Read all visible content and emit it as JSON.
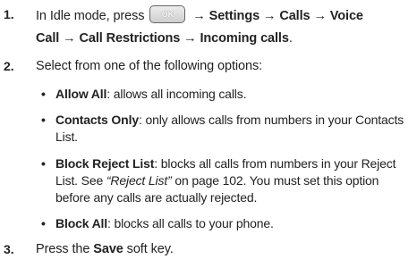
{
  "step1": {
    "number": "1.",
    "pre": "In Idle mode, press",
    "ok_key": "OK",
    "arrow1": "→",
    "settings": "Settings",
    "arrow2": "→",
    "calls": "Calls",
    "arrow3": "→",
    "voice": "Voice",
    "line2_call": "Call",
    "arrow4": "→",
    "call_restrictions": "Call Restrictions",
    "arrow5": "→",
    "incoming_calls": "Incoming calls",
    "period": "."
  },
  "step2": {
    "number": "2.",
    "text": "Select from one of the following options:"
  },
  "options": [
    {
      "term": "Allow All",
      "line1": ": allows all incoming calls."
    },
    {
      "term": "Contacts Only",
      "line1": ": only allows calls from numbers in your Contacts",
      "line2": "List."
    },
    {
      "term": "Block Reject List",
      "line1": ": blocks all calls from numbers in your Reject",
      "line2_pre": "List. See ",
      "line2_ref": "“Reject List”",
      "line2_post": " on page 102. You must set this option",
      "line3": "before any calls are actually rejected."
    },
    {
      "term": "Block All",
      "line1": ": blocks all calls to your phone."
    }
  ],
  "bullet_char": "•",
  "step3": {
    "number": "3.",
    "pre": "Press the ",
    "save": "Save",
    "post": " soft key."
  }
}
